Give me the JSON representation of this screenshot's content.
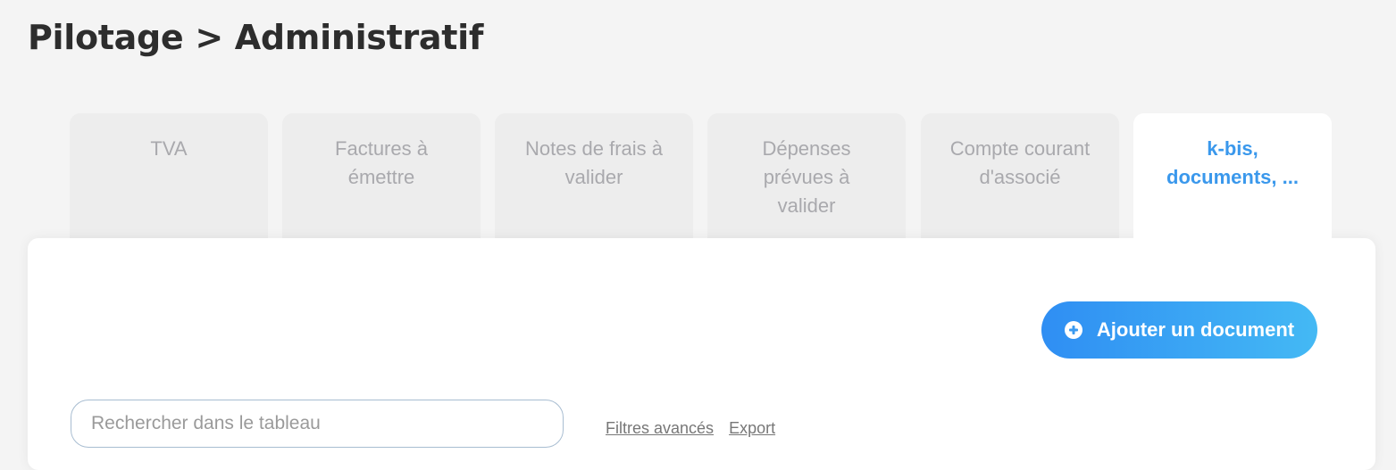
{
  "header": {
    "title": "Pilotage > Administratif"
  },
  "tabs": [
    {
      "lines": [
        "TVA"
      ],
      "active": false
    },
    {
      "lines": [
        "Factures à",
        "émettre"
      ],
      "active": false
    },
    {
      "lines": [
        "Notes de frais à",
        "valider"
      ],
      "active": false
    },
    {
      "lines": [
        "Dépenses",
        "prévues à",
        "valider"
      ],
      "active": false
    },
    {
      "lines": [
        "Compte courant",
        "d'associé"
      ],
      "active": false
    },
    {
      "lines": [
        "k-bis,",
        "documents, ..."
      ],
      "active": true
    }
  ],
  "toolbar": {
    "add_label": "Ajouter un document",
    "add_icon": "plus-circle-icon"
  },
  "search": {
    "placeholder": "Rechercher dans le tableau",
    "value": ""
  },
  "links": {
    "filters": "Filtres avancés",
    "export": "Export"
  },
  "colors": {
    "accent": "#3a98ec",
    "button_gradient_start": "#2f8ef3",
    "button_gradient_end": "#44b9f4",
    "inactive_tab_text": "#a9a9ad",
    "inactive_tab_bg": "#ededed",
    "page_bg": "#f4f4f4"
  }
}
